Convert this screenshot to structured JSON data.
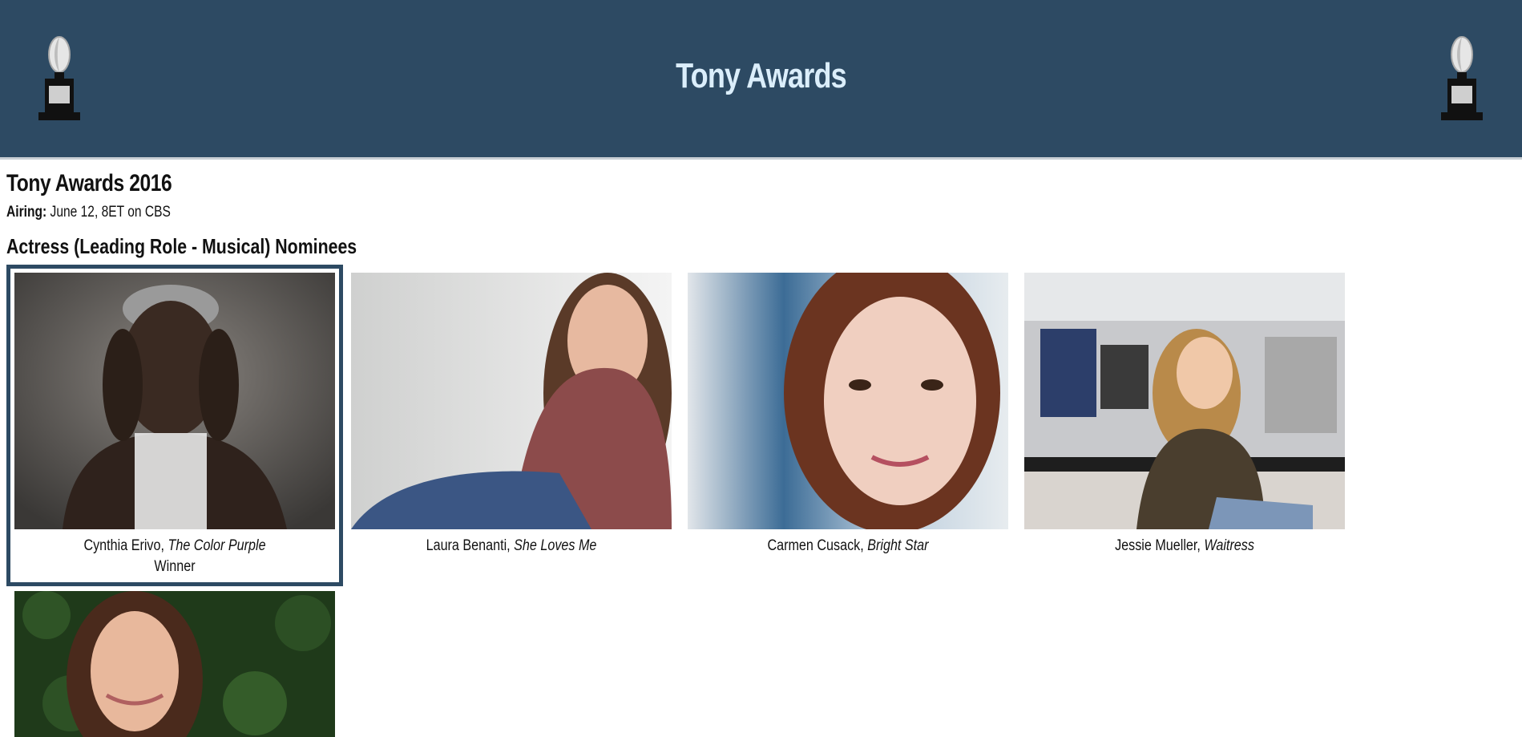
{
  "header": {
    "title": "Tony Awards",
    "logo_left": "tony-trophy-icon",
    "logo_right": "tony-trophy-icon"
  },
  "page": {
    "title": "Tony Awards 2016",
    "airing_label": "Airing:",
    "airing_value": "June 12, 8ET on CBS",
    "category": "Actress (Leading Role - Musical) Nominees"
  },
  "nominees": [
    {
      "name": "Cynthia Erivo,",
      "show": "The Color Purple",
      "status": "Winner"
    },
    {
      "name": "Laura Benanti,",
      "show": "She Loves Me",
      "status": ""
    },
    {
      "name": "Carmen Cusack,",
      "show": "Bright Star",
      "status": ""
    },
    {
      "name": "Jessie Mueller,",
      "show": "Waitress",
      "status": ""
    },
    {
      "name": "",
      "show": "",
      "status": ""
    }
  ],
  "colors": {
    "header_bg": "#2d4a63",
    "header_title": "#dbeefb",
    "winner_border": "#2d4a63"
  }
}
